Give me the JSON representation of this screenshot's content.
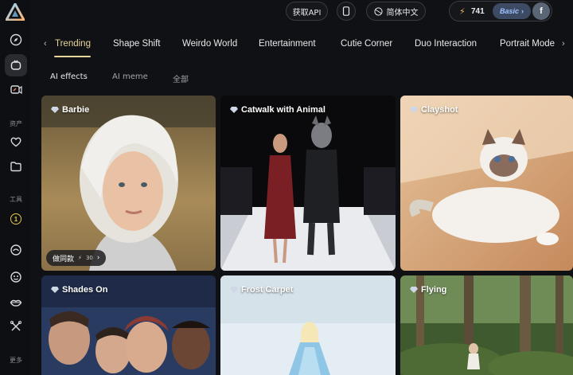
{
  "header": {
    "api_label": "获取API",
    "lang_label": "简体中文",
    "credits": "741",
    "plan_label": "Basic",
    "avatar_letter": "f"
  },
  "sidebar": {
    "section_assets": "资产",
    "section_tools": "工具",
    "section_more": "更多",
    "badge_number": "1"
  },
  "tabs": [
    "Trending",
    "Shape Shift",
    "Weirdo World",
    "Entertainment",
    "Cutie Corner",
    "Duo Interaction",
    "Portrait Mode"
  ],
  "subtabs": [
    "AI effects",
    "AI meme",
    "全部"
  ],
  "cards": [
    {
      "title": "Barbie",
      "action_label": "做同款",
      "action_count": "30"
    },
    {
      "title": "Catwalk with Animal"
    },
    {
      "title": "Clayshot"
    },
    {
      "title": "Shades On"
    },
    {
      "title": "Frost Carpet"
    },
    {
      "title": "Flying"
    }
  ],
  "colors": {
    "accent": "#e8d59c",
    "background": "#101114",
    "plan": "#3d4a63"
  }
}
